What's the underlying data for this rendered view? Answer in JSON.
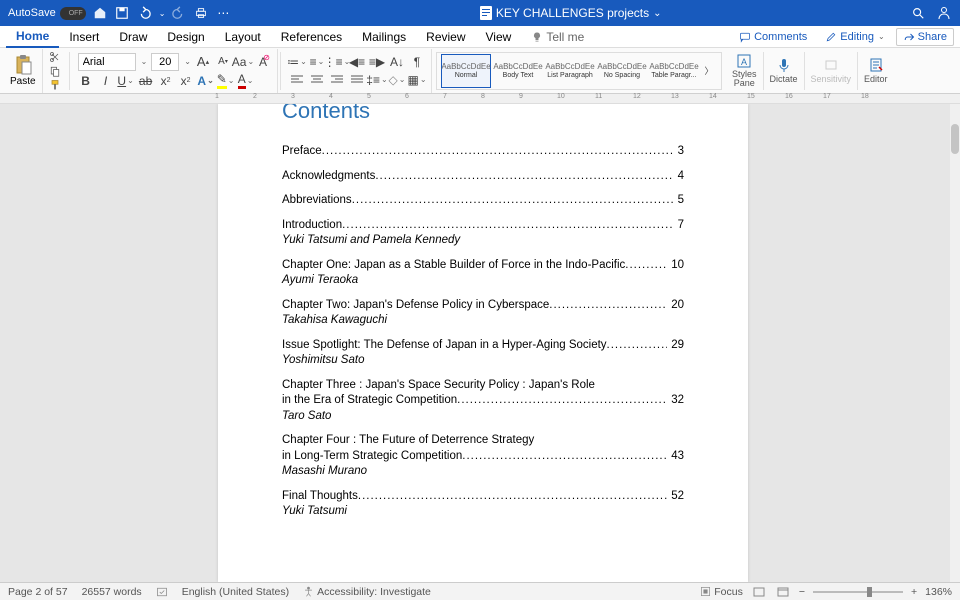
{
  "titlebar": {
    "autosave_label": "AutoSave",
    "autosave_state": "OFF",
    "doc_title": "KEY CHALLENGES projects"
  },
  "menu": {
    "items": [
      "Home",
      "Insert",
      "Draw",
      "Design",
      "Layout",
      "References",
      "Mailings",
      "Review",
      "View"
    ],
    "tellme": "Tell me",
    "comments": "Comments",
    "editing": "Editing",
    "share": "Share"
  },
  "ribbon": {
    "paste": "Paste",
    "font_name": "Arial",
    "font_size": "20",
    "styles": [
      {
        "sample": "AaBbCcDdEe",
        "name": "Normal"
      },
      {
        "sample": "AaBbCcDdEe",
        "name": "Body Text"
      },
      {
        "sample": "AaBbCcDdEe",
        "name": "List Paragraph"
      },
      {
        "sample": "AaBbCcDdEe",
        "name": "No Spacing"
      },
      {
        "sample": "AaBbCcDdEe",
        "name": "Table Paragr..."
      }
    ],
    "styles_pane": "Styles\nPane",
    "dictate": "Dictate",
    "sensitivity": "Sensitivity",
    "editor": "Editor"
  },
  "document": {
    "heading": "Contents",
    "toc": [
      {
        "title": "Preface",
        "page": "3",
        "author": ""
      },
      {
        "title": "Acknowledgments",
        "page": "4",
        "author": ""
      },
      {
        "title": "Abbreviations",
        "page": "5",
        "author": ""
      },
      {
        "title": "Introduction",
        "page": "7",
        "author": "Yuki Tatsumi and Pamela Kennedy"
      },
      {
        "title": "Chapter One: Japan as a Stable Builder of Force in the Indo-Pacific",
        "page": "10",
        "author": "Ayumi Teraoka"
      },
      {
        "title": "Chapter Two: Japan's Defense Policy in Cyberspace",
        "page": "20",
        "author": "Takahisa Kawaguchi"
      },
      {
        "title": "Issue Spotlight: The Defense of Japan in a Hyper-Aging Society",
        "page": "29",
        "author": "Yoshimitsu Sato"
      },
      {
        "title": "Chapter Three : Japan's Space Security Policy : Japan's Role",
        "title2": "in the Era of Strategic Competition",
        "page": "32",
        "author": "Taro Sato"
      },
      {
        "title": "Chapter Four : The Future of Deterrence Strategy",
        "title2": "in Long-Term Strategic Competition",
        "page": "43",
        "author": "Masashi Murano"
      },
      {
        "title": "Final Thoughts",
        "page": "52",
        "author": "Yuki Tatsumi"
      }
    ]
  },
  "statusbar": {
    "page": "Page 2 of 57",
    "words": "26557 words",
    "language": "English (United States)",
    "accessibility": "Accessibility: Investigate",
    "focus": "Focus",
    "zoom": "136%"
  },
  "ruler_marks": [
    "1",
    "2",
    "3",
    "4",
    "5",
    "6",
    "7",
    "8",
    "9",
    "10",
    "11",
    "12",
    "13",
    "14",
    "15",
    "16",
    "17",
    "18"
  ]
}
